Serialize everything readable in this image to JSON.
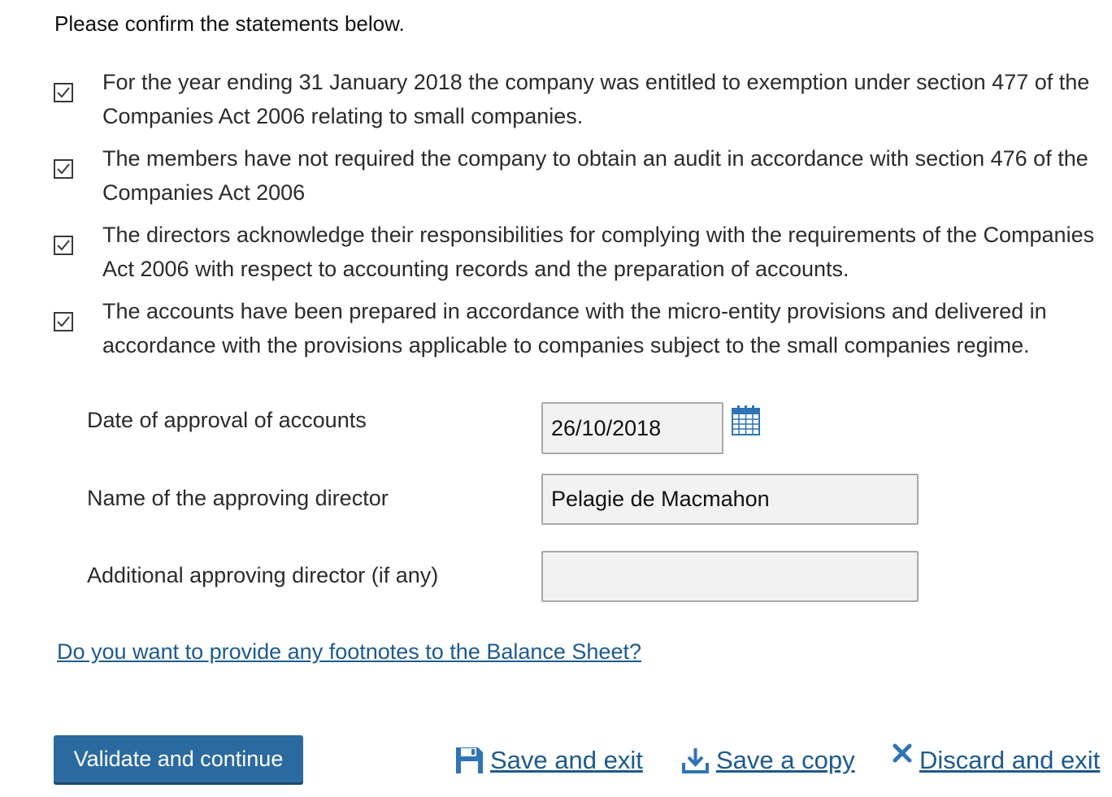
{
  "intro": "Please confirm the statements below.",
  "statements": [
    {
      "checked": true,
      "text": "For the year ending 31 January 2018 the company was entitled to exemption under section 477 of the Companies Act 2006 relating to small companies."
    },
    {
      "checked": true,
      "text": "The members have not required the company to obtain an audit in accordance with section 476 of the Companies Act 2006"
    },
    {
      "checked": true,
      "text": "The directors acknowledge their responsibilities for complying with the requirements of the Companies Act 2006 with respect to accounting records and the preparation of accounts."
    },
    {
      "checked": true,
      "text": "The accounts have been prepared in accordance with the micro-entity provisions and delivered in accordance with the provisions applicable to companies subject to the small companies regime."
    }
  ],
  "form": {
    "date_label": "Date of approval of accounts",
    "date_value": "26/10/2018",
    "director_label": "Name of the approving director",
    "director_value": "Pelagie de Macmahon",
    "additional_label": "Additional approving director (if any)",
    "additional_value": ""
  },
  "footnote_link": "Do you want to provide any footnotes to the Balance Sheet?",
  "actions": {
    "validate": "Validate and continue",
    "save_exit": "Save and exit",
    "save_copy": "Save a copy",
    "discard_exit": "Discard and exit"
  },
  "icons": {
    "calendar": "calendar-icon",
    "save": "floppy-disk-icon",
    "download": "download-icon",
    "discard": "close-icon"
  },
  "colors": {
    "primary_button": "#2b6aa0",
    "link": "#1d5a8e",
    "field_bg": "#f2f2f2"
  }
}
